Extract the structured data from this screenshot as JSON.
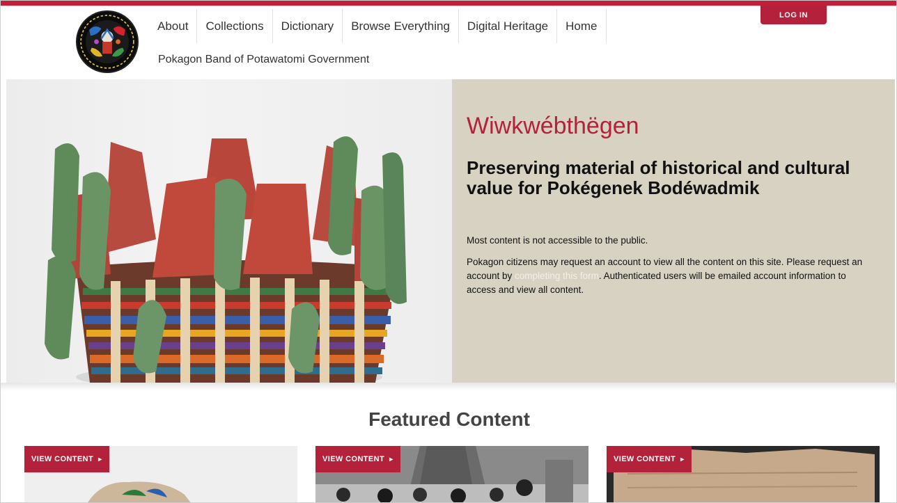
{
  "header": {
    "nav": [
      "About",
      "Collections",
      "Dictionary",
      "Browse Everything",
      "Digital Heritage",
      "Home"
    ],
    "site_name": "Pokagon Band of Potawatomi Government",
    "login_label": "LOG IN"
  },
  "hero": {
    "title": "Wiwkwébthëgen",
    "subtitle": "Preserving material of historical and cultural value for Pokégenek Bodéwadmik",
    "note": "Most content is not accessible to the public.",
    "body_before_link": "Pokagon citizens may request an account to view all the content on this site. Please request an account by ",
    "link_text": "completing this form",
    "body_after_link": ". Authenticated users will be emailed account information to access and view all content."
  },
  "featured": {
    "heading": "Featured Content",
    "cards": [
      {
        "button": "VIEW CONTENT",
        "arrow": "▸"
      },
      {
        "button": "VIEW CONTENT",
        "arrow": "▸"
      },
      {
        "button": "VIEW CONTENT",
        "arrow": "▸"
      }
    ]
  },
  "colors": {
    "accent": "#b3213b",
    "hero_panel": "#d7d2c1",
    "top_bar": "#c2203a"
  },
  "icons": {
    "logo": "pokagon-band-seal",
    "card_arrow": "caret-right-icon"
  }
}
